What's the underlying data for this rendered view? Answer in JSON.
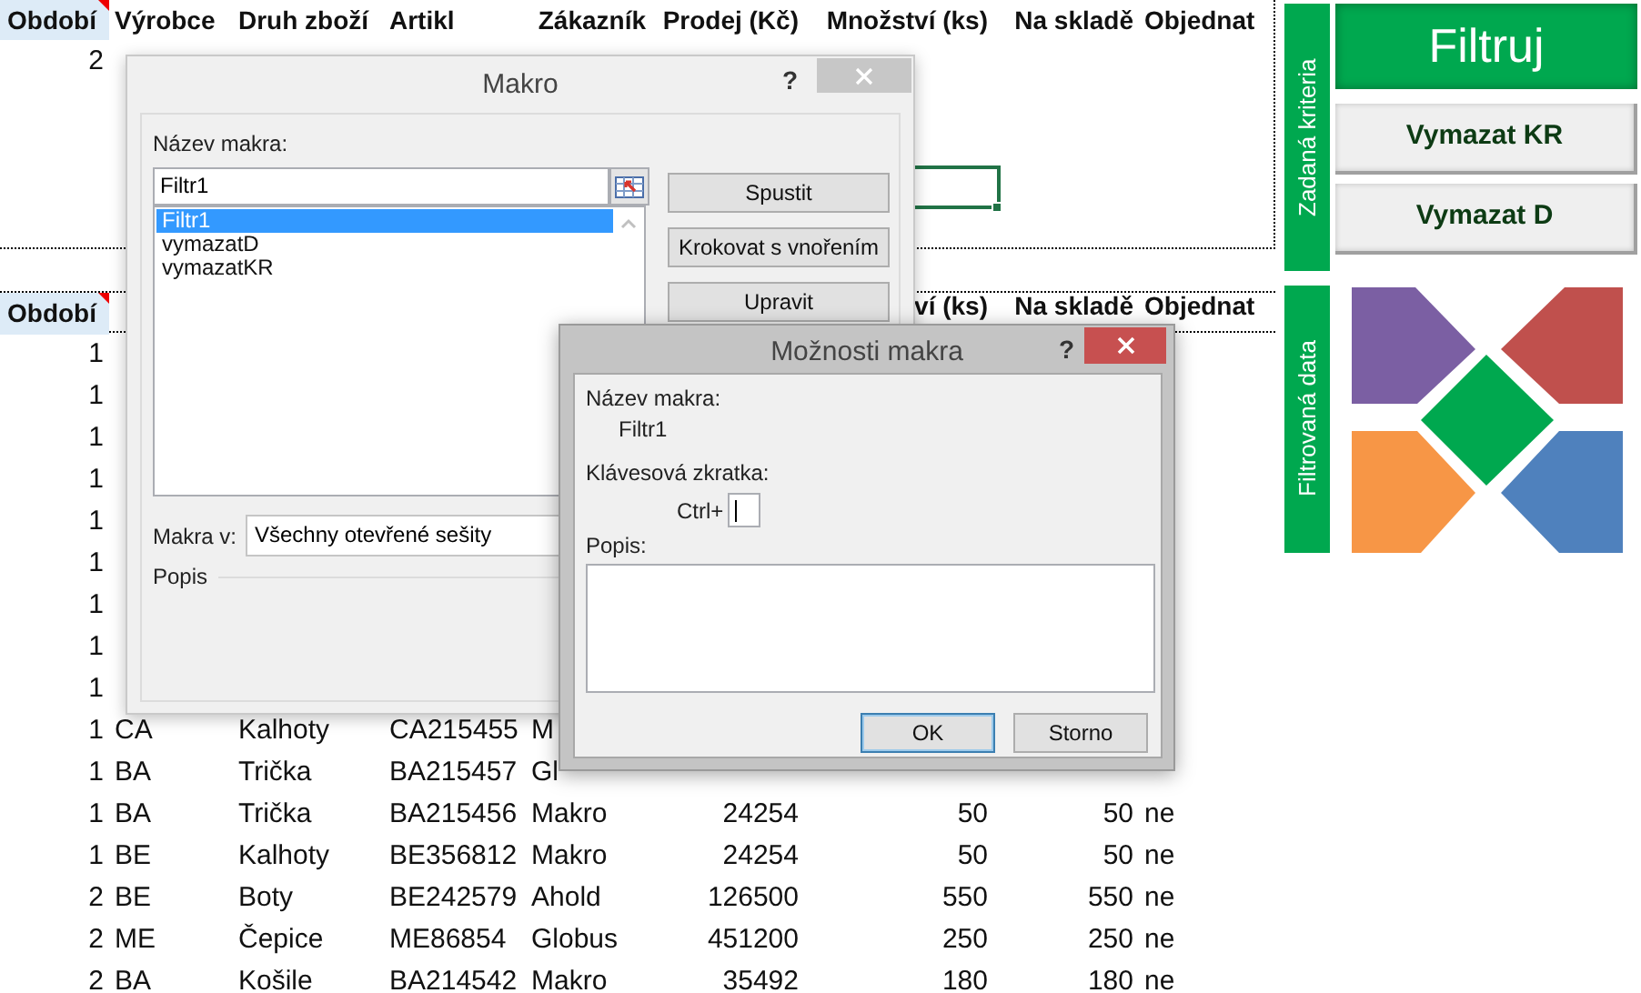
{
  "sheet": {
    "criteria_header": {
      "obdobi": "Období",
      "vyrobce": "Výrobce",
      "druh": "Druh zboží",
      "artikl": "Artikl",
      "zakaznik": "Zákazník",
      "prodej": "Prodej (Kč)",
      "mnozstvi": "Množství (ks)",
      "sklad": "Na skladě",
      "objednat": "Objednat"
    },
    "criteria_rows": [
      {
        "obdobi": "2"
      }
    ],
    "data_header": {
      "obdobi": "Období",
      "mnozstvi": "ví (ks)",
      "sklad": "Na skladě",
      "objednat": "Objednat"
    },
    "data_rows": [
      {
        "obdobi": "1"
      },
      {
        "obdobi": "1"
      },
      {
        "obdobi": "1"
      },
      {
        "obdobi": "1"
      },
      {
        "obdobi": "1"
      },
      {
        "obdobi": "1"
      },
      {
        "obdobi": "1"
      },
      {
        "obdobi": "1"
      },
      {
        "obdobi": "1"
      },
      {
        "obdobi": "1",
        "vyrobce": "CA",
        "druh": "Kalhoty",
        "artikl": "CA215455",
        "zakaznik": "M"
      },
      {
        "obdobi": "1",
        "vyrobce": "BA",
        "druh": "Trička",
        "artikl": "BA215457",
        "zakaznik": "Gl"
      },
      {
        "obdobi": "1",
        "vyrobce": "BA",
        "druh": "Trička",
        "artikl": "BA215456",
        "zakaznik": "Makro",
        "prodej": "24254",
        "mnozstvi": "50",
        "sklad": "50",
        "objednat": "ne"
      },
      {
        "obdobi": "1",
        "vyrobce": "BE",
        "druh": "Kalhoty",
        "artikl": "BE356812",
        "zakaznik": "Makro",
        "prodej": "24254",
        "mnozstvi": "50",
        "sklad": "50",
        "objednat": "ne"
      },
      {
        "obdobi": "2",
        "vyrobce": "BE",
        "druh": "Boty",
        "artikl": "BE242579",
        "zakaznik": "Ahold",
        "prodej": "126500",
        "mnozstvi": "550",
        "sklad": "550",
        "objednat": "ne"
      },
      {
        "obdobi": "2",
        "vyrobce": "ME",
        "druh": "Čepice",
        "artikl": "ME86854",
        "zakaznik": "Globus",
        "prodej": "451200",
        "mnozstvi": "250",
        "sklad": "250",
        "objednat": "ne"
      },
      {
        "obdobi": "2",
        "vyrobce": "BA",
        "druh": "Košile",
        "artikl": "BA214542",
        "zakaznik": "Makro",
        "prodej": "35492",
        "mnozstvi": "180",
        "sklad": "180",
        "objednat": "ne"
      }
    ]
  },
  "side_panel": {
    "criteria_label": "Zadaná kriteria",
    "buttons": [
      {
        "label": "Filtruj",
        "kind": "primary"
      },
      {
        "label": "Vymazat KR",
        "kind": "secondary"
      },
      {
        "label": "Vymazat D",
        "kind": "secondary"
      }
    ],
    "data_label": "Filtrovaná data"
  },
  "macro_dialog": {
    "title": "Makro",
    "help": "?",
    "name_label": "Název makra:",
    "name_value": "Filtr1",
    "macros": [
      {
        "name": "Filtr1",
        "selected": true
      },
      {
        "name": "vymazatD",
        "selected": false
      },
      {
        "name": "vymazatKR",
        "selected": false
      }
    ],
    "buttons": [
      "Spustit",
      "Krokovat s vnořením",
      "Upravit"
    ],
    "location_label": "Makra v:",
    "location_value": "Všechny otevřené sešity",
    "description_label": "Popis"
  },
  "options_dialog": {
    "title": "Možnosti makra",
    "help": "?",
    "name_label": "Název makra:",
    "name_value": "Filtr1",
    "shortcut_label": "Klávesová zkratka:",
    "shortcut_prefix": "Ctrl+",
    "description_label": "Popis:",
    "buttons": [
      {
        "label": "OK",
        "default": true
      },
      {
        "label": "Storno",
        "default": false
      }
    ]
  }
}
